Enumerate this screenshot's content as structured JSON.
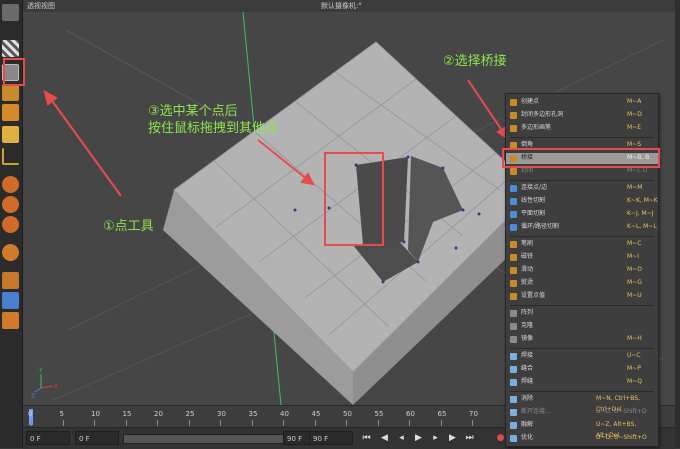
{
  "viewport": {
    "title": "透视视图",
    "camera": "默认摄像机:°"
  },
  "annotations": {
    "point_tool": "①点工具",
    "select_bridge": "②选择桥接",
    "drag_line1": "③选中某个点后",
    "drag_line2": "按住鼠标拖拽到其他点"
  },
  "menu": {
    "items": [
      {
        "label": "创建点",
        "shortcut": "M~A",
        "icon_color": "#c98a2a",
        "state": "normal"
      },
      {
        "label": "封闭多边形孔洞",
        "shortcut": "M~D",
        "icon_color": "#c98a2a",
        "state": "normal"
      },
      {
        "label": "多边形画笔",
        "shortcut": "M~E",
        "icon_color": "#c98a2a",
        "state": "normal"
      },
      {
        "label": "倒角",
        "shortcut": "M~S",
        "icon_color": "#c98a2a",
        "state": "normal"
      },
      {
        "label": "桥接",
        "shortcut": "M~B, B",
        "icon_color": "#c98a2a",
        "state": "highlight"
      },
      {
        "label": "封闭",
        "shortcut": "M~I, U",
        "icon_color": "#c98a2a",
        "state": "disabled"
      },
      {
        "label": "连接点/边",
        "shortcut": "M~M",
        "icon_color": "#4a8fd6",
        "state": "normal"
      },
      {
        "label": "线性切割",
        "shortcut": "K~K, M~K",
        "icon_color": "#4a8fd6",
        "state": "normal"
      },
      {
        "label": "平面切割",
        "shortcut": "K~J, M~J",
        "icon_color": "#4a8fd6",
        "state": "normal"
      },
      {
        "label": "循环/路径切割",
        "shortcut": "K~L, M~L",
        "icon_color": "#4a8fd6",
        "state": "normal"
      },
      {
        "label": "笔刷",
        "shortcut": "M~C",
        "icon_color": "#c98a2a",
        "state": "normal"
      },
      {
        "label": "磁铁",
        "shortcut": "M~I",
        "icon_color": "#c98a2a",
        "state": "normal"
      },
      {
        "label": "滑动",
        "shortcut": "M~O",
        "icon_color": "#c98a2a",
        "state": "normal"
      },
      {
        "label": "熨烫",
        "shortcut": "M~G",
        "icon_color": "#c98a2a",
        "state": "normal"
      },
      {
        "label": "设置点值",
        "shortcut": "M~U",
        "icon_color": "#c98a2a",
        "state": "normal"
      },
      {
        "label": "阵列",
        "shortcut": "",
        "icon_color": "#8a8a8a",
        "state": "normal"
      },
      {
        "label": "克隆",
        "shortcut": "",
        "icon_color": "#8a8a8a",
        "state": "normal"
      },
      {
        "label": "镜像",
        "shortcut": "M~H",
        "icon_color": "#8a8a8a",
        "state": "normal"
      },
      {
        "label": "焊接",
        "shortcut": "U~C",
        "icon_color": "#7ab0e0",
        "state": "normal"
      },
      {
        "label": "缝合",
        "shortcut": "M~P",
        "icon_color": "#7ab0e0",
        "state": "normal"
      },
      {
        "label": "焊缝",
        "shortcut": "M~Q",
        "icon_color": "#7ab0e0",
        "state": "normal"
      },
      {
        "label": "消除",
        "shortcut": "M~N, Ctrl+BS, Ctrl+Del",
        "icon_color": "#7ab0e0",
        "state": "normal"
      },
      {
        "label": "断开连接...",
        "shortcut": "U~D, U~Shift+D",
        "icon_color": "#7ab0e0",
        "state": "disabled"
      },
      {
        "label": "融解",
        "shortcut": "U~Z, Alt+BS, Alt+Del",
        "icon_color": "#7ab0e0",
        "state": "normal"
      },
      {
        "label": "优化",
        "shortcut": "U~O, U~Shift+O",
        "icon_color": "#7ab0e0",
        "state": "normal"
      }
    ]
  },
  "timeline": {
    "ticks": [
      "0",
      "5",
      "10",
      "15",
      "20",
      "25",
      "30",
      "35",
      "40",
      "45",
      "50",
      "55",
      "60",
      "65",
      "70"
    ]
  },
  "transport": {
    "current_frame": "0 F",
    "start_frame": "0 F",
    "end_frame": "90 F",
    "end_frame_2": "90 F"
  },
  "colors": {
    "annotation_green": "#8ee64d",
    "annotation_red": "#e74c4c",
    "menu_highlight": "#9a9a9a"
  }
}
